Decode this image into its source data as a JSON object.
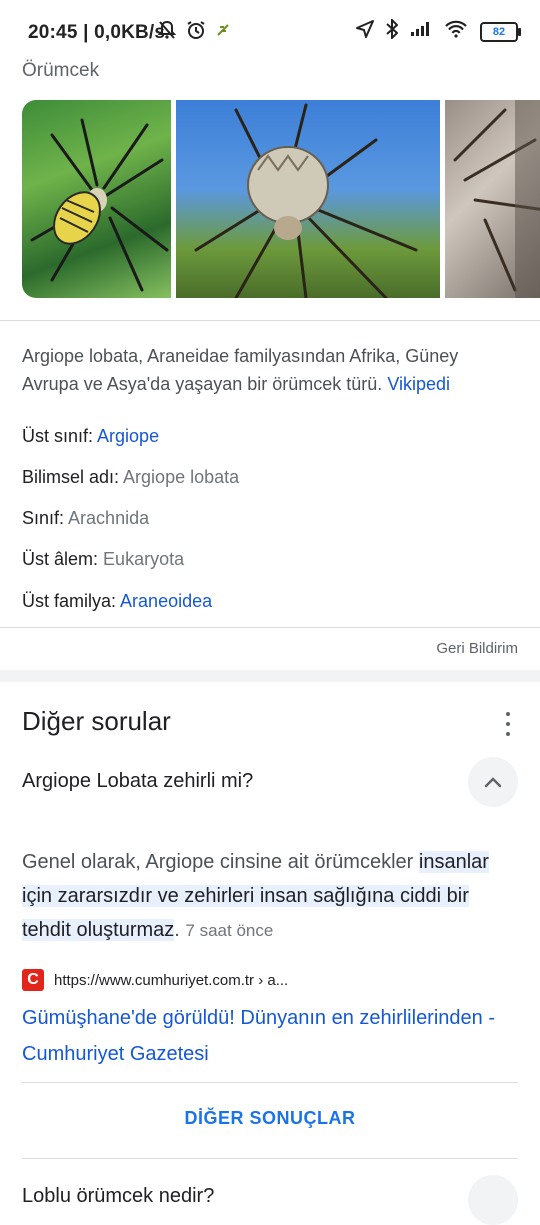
{
  "status_bar": {
    "time_speed": "20:45 | 0,0KB/s",
    "battery": "82"
  },
  "knowledge_panel": {
    "section_title": "Örümcek",
    "description": "Argiope lobata, Araneidae familyasından Afrika, Güney Avrupa ve Asya'da yaşayan bir örümcek türü.",
    "source_link": "Vikipedi",
    "facts": [
      {
        "label": "Üst sınıf:",
        "value": "Argiope"
      },
      {
        "label": "Bilimsel adı:",
        "value": "Argiope lobata"
      },
      {
        "label": "Sınıf:",
        "value": "Arachnida"
      },
      {
        "label": "Üst âlem:",
        "value": "Eukaryota"
      },
      {
        "label": "Üst familya:",
        "value": "Araneoidea"
      }
    ],
    "feedback": "Geri Bildirim"
  },
  "other_questions": {
    "title": "Diğer sorular",
    "question1": "Argiope Lobata zehirli mi?",
    "answer_prefix": "Genel olarak, Argiope cinsine ait örümcekler",
    "answer_highlight": "insanlar için zararsızdır ve zehirleri insan sağlığına ciddi bir tehdit oluşturmaz",
    "answer_suffix": ".",
    "answer_time": "7 saat önce",
    "source_url": "https://www.cumhuriyet.com.tr › a...",
    "result_title": "Gümüşhane'de görüldü! Dünyanın en zehirlilerinden - Cumhuriyet Gazetesi",
    "more_results": "DİĞER SONUÇLAR",
    "question2": "Loblu örümcek nedir?"
  },
  "icons": {
    "favicon_letter": "C"
  }
}
